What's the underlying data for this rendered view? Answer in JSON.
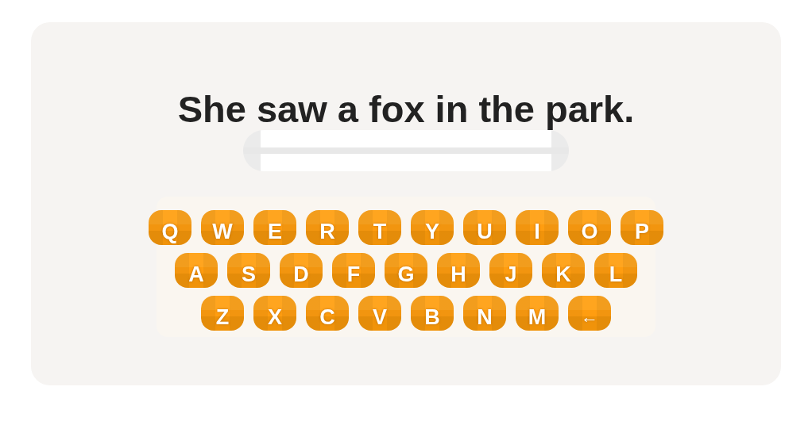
{
  "sentence": "She saw a fox in the park.",
  "keyboard": {
    "rows": [
      {
        "keys": [
          {
            "label": "Q",
            "kind": "letter"
          },
          {
            "label": "W",
            "kind": "letter"
          },
          {
            "label": "E",
            "kind": "letter"
          },
          {
            "label": "R",
            "kind": "letter"
          },
          {
            "label": "T",
            "kind": "letter"
          },
          {
            "label": "Y",
            "kind": "letter"
          },
          {
            "label": "U",
            "kind": "letter"
          },
          {
            "label": "I",
            "kind": "letter"
          },
          {
            "label": "O",
            "kind": "letter"
          },
          {
            "label": "P",
            "kind": "letter"
          }
        ]
      },
      {
        "keys": [
          {
            "label": "A",
            "kind": "letter"
          },
          {
            "label": "S",
            "kind": "letter"
          },
          {
            "label": "D",
            "kind": "letter"
          },
          {
            "label": "F",
            "kind": "letter"
          },
          {
            "label": "G",
            "kind": "letter"
          },
          {
            "label": "H",
            "kind": "letter"
          },
          {
            "label": "J",
            "kind": "letter"
          },
          {
            "label": "K",
            "kind": "letter"
          },
          {
            "label": "L",
            "kind": "letter"
          }
        ]
      },
      {
        "keys": [
          {
            "label": "Z",
            "kind": "letter"
          },
          {
            "label": "X",
            "kind": "letter"
          },
          {
            "label": "C",
            "kind": "letter"
          },
          {
            "label": "V",
            "kind": "letter"
          },
          {
            "label": "B",
            "kind": "letter"
          },
          {
            "label": "N",
            "kind": "letter"
          },
          {
            "label": "M",
            "kind": "letter"
          },
          {
            "label": "←",
            "kind": "backspace"
          }
        ]
      }
    ]
  }
}
